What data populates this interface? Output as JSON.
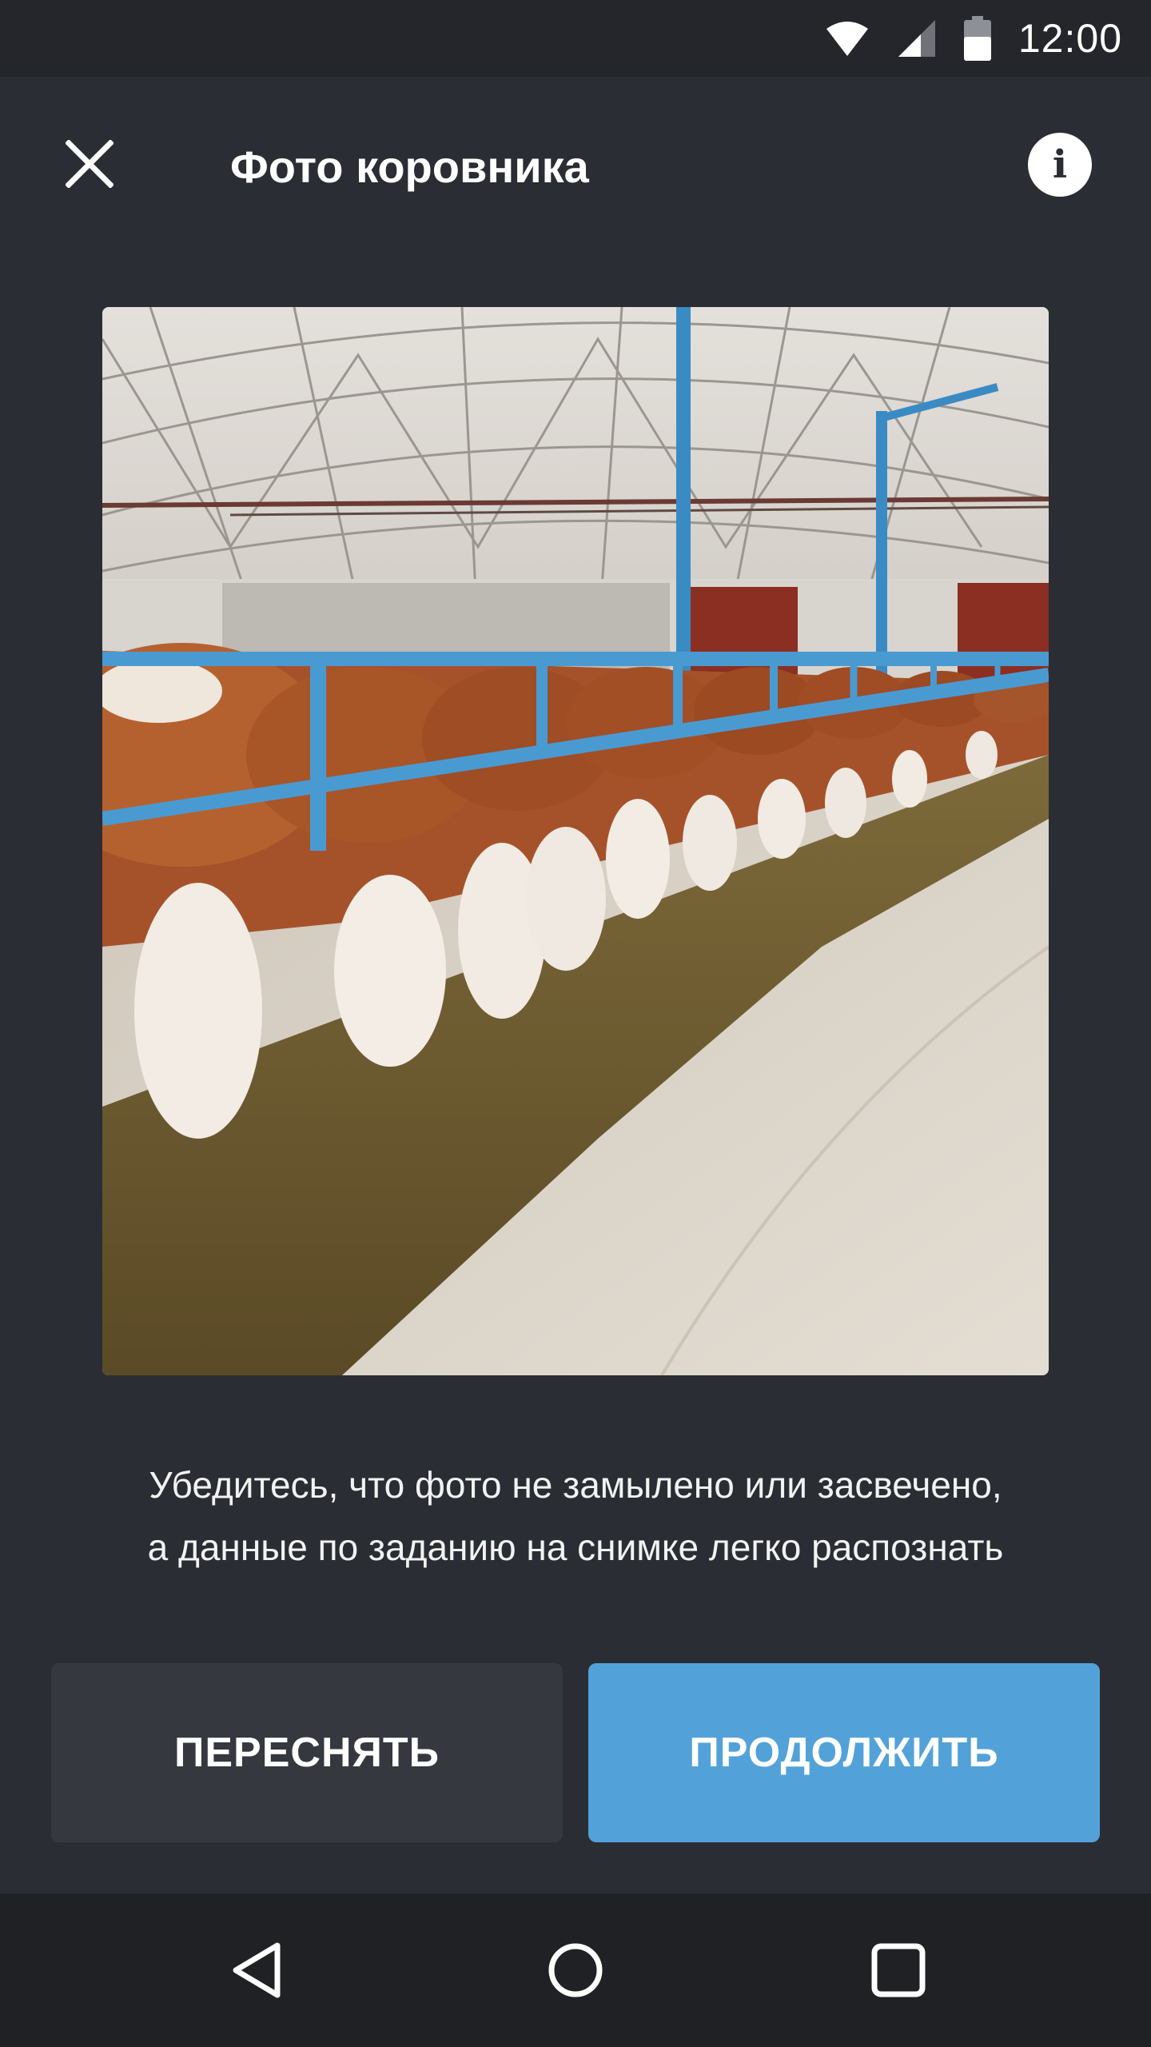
{
  "status_bar": {
    "time": "12:00",
    "icons": [
      "wifi-icon",
      "cell-signal-icon",
      "battery-icon"
    ]
  },
  "app_bar": {
    "title": "Фото коровника",
    "close_icon": "close-icon",
    "info_icon": "info-icon",
    "info_glyph": "i"
  },
  "photo": {
    "subject": "cowshed-photo"
  },
  "hint": {
    "line1": "Убедитесь, что фото не замылено или засвечено,",
    "line2": "а данные по заданию на снимке легко распознать"
  },
  "buttons": {
    "retake_label": "ПЕРЕСНЯТЬ",
    "continue_label": "ПРОДОЛЖИТЬ"
  },
  "nav_bar": {
    "icons": [
      "back-icon",
      "home-icon",
      "recents-icon"
    ]
  },
  "colors": {
    "background": "#2a2d33",
    "status_bar": "#24262b",
    "nav_bar": "#1f2125",
    "secondary_button": "#35383f",
    "primary_button": "#52a2d9"
  }
}
